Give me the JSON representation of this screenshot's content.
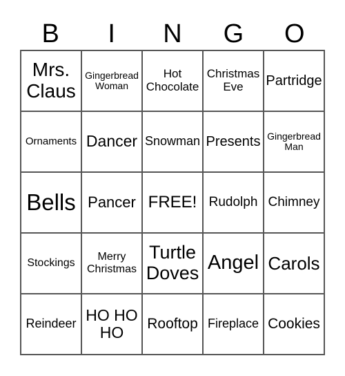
{
  "header": [
    "B",
    "I",
    "N",
    "G",
    "O"
  ],
  "cells": [
    {
      "text": "Mrs. Claus",
      "size": "28"
    },
    {
      "text": "Gingerbread Woman",
      "size": "14"
    },
    {
      "text": "Hot Chocolate",
      "size": "17"
    },
    {
      "text": "Christmas Eve",
      "size": "17"
    },
    {
      "text": "Partridge",
      "size": "20"
    },
    {
      "text": "Ornaments",
      "size": "15"
    },
    {
      "text": "Dancer",
      "size": "23"
    },
    {
      "text": "Snowman",
      "size": "18"
    },
    {
      "text": "Presents",
      "size": "20"
    },
    {
      "text": "Gingerbread Man",
      "size": "14"
    },
    {
      "text": "Bells",
      "size": "33"
    },
    {
      "text": "Pancer",
      "size": "22"
    },
    {
      "text": "FREE!",
      "size": "24"
    },
    {
      "text": "Rudolph",
      "size": "19"
    },
    {
      "text": "Chimney",
      "size": "19"
    },
    {
      "text": "Stockings",
      "size": "16"
    },
    {
      "text": "Merry Christmas",
      "size": "16"
    },
    {
      "text": "Turtle Doves",
      "size": "27"
    },
    {
      "text": "Angel",
      "size": "29"
    },
    {
      "text": "Carols",
      "size": "26"
    },
    {
      "text": "Reindeer",
      "size": "18"
    },
    {
      "text": "HO HO HO",
      "size": "23"
    },
    {
      "text": "Rooftop",
      "size": "21"
    },
    {
      "text": "Fireplace",
      "size": "18"
    },
    {
      "text": "Cookies",
      "size": "21"
    }
  ]
}
